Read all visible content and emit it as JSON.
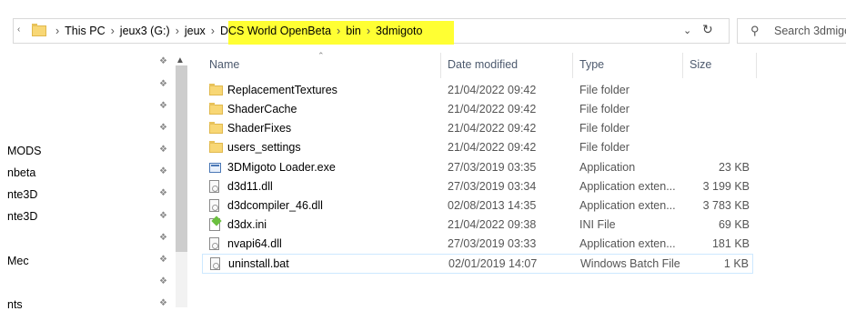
{
  "address_bar": {
    "crumbs": [
      "This PC",
      "jeux3 (G:)",
      "jeux",
      "DCS World OpenBeta",
      "bin",
      "3dmigoto"
    ]
  },
  "search": {
    "placeholder": "Search 3dmigo"
  },
  "nav_items": [
    "MODS",
    "nbeta",
    "nte3D",
    "nte3D",
    "Mec",
    "nts"
  ],
  "columns": {
    "name": "Name",
    "date": "Date modified",
    "type": "Type",
    "size": "Size"
  },
  "files": [
    {
      "name": "ReplacementTextures",
      "date": "21/04/2022 09:42",
      "type": "File folder",
      "size": "",
      "icon": "folder-icon"
    },
    {
      "name": "ShaderCache",
      "date": "21/04/2022 09:42",
      "type": "File folder",
      "size": "",
      "icon": "folder-icon"
    },
    {
      "name": "ShaderFixes",
      "date": "21/04/2022 09:42",
      "type": "File folder",
      "size": "",
      "icon": "folder-icon"
    },
    {
      "name": "users_settings",
      "date": "21/04/2022 09:42",
      "type": "File folder",
      "size": "",
      "icon": "folder-icon"
    },
    {
      "name": "3DMigoto Loader.exe",
      "date": "27/03/2019 03:35",
      "type": "Application",
      "size": "23 KB",
      "icon": "exe-icon"
    },
    {
      "name": "d3d11.dll",
      "date": "27/03/2019 03:34",
      "type": "Application exten...",
      "size": "3 199 KB",
      "icon": "dll-icon"
    },
    {
      "name": "d3dcompiler_46.dll",
      "date": "02/08/2013 14:35",
      "type": "Application exten...",
      "size": "3 783 KB",
      "icon": "dll-icon"
    },
    {
      "name": "d3dx.ini",
      "date": "21/04/2022 09:38",
      "type": "INI File",
      "size": "69 KB",
      "icon": "ini-icon"
    },
    {
      "name": "nvapi64.dll",
      "date": "27/03/2019 03:33",
      "type": "Application exten...",
      "size": "181 KB",
      "icon": "dll-icon"
    },
    {
      "name": "uninstall.bat",
      "date": "02/01/2019 14:07",
      "type": "Windows Batch File",
      "size": "1 KB",
      "icon": "bat-icon"
    }
  ]
}
